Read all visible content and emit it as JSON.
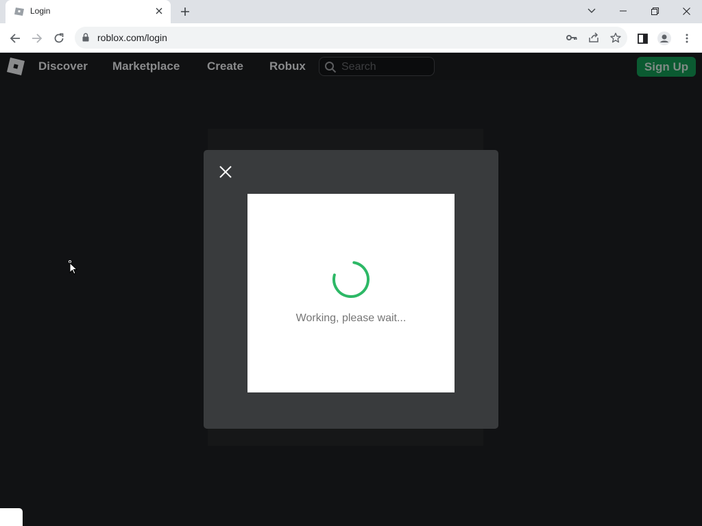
{
  "browser": {
    "tab_title": "Login",
    "url": "roblox.com/login"
  },
  "nav": {
    "links": [
      "Discover",
      "Marketplace",
      "Create",
      "Robux"
    ],
    "search_placeholder": "Search",
    "signup_label": "Sign Up"
  },
  "modal": {
    "status_text": "Working, please wait..."
  },
  "colors": {
    "spinner": "#2db866",
    "signup": "#0b5a31",
    "page_bg": "#111214",
    "modal_bg": "#393b3d"
  }
}
